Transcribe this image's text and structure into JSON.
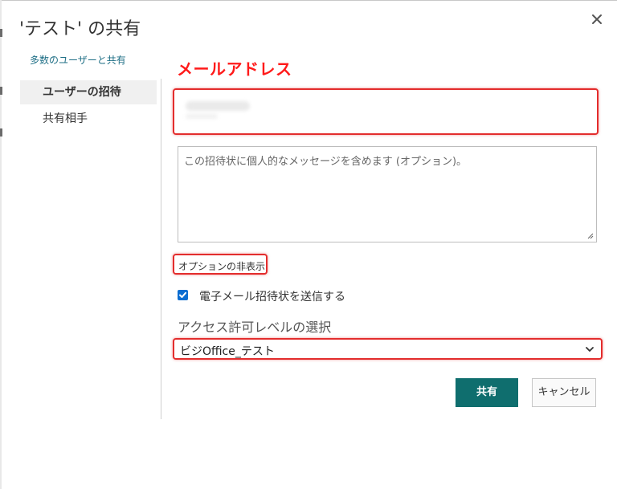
{
  "dialog": {
    "title": "'テスト' の共有",
    "manage_link": "多数のユーザーと共有"
  },
  "nav": {
    "items": [
      {
        "label": "ユーザーの招待",
        "active": true
      },
      {
        "label": "共有相手",
        "active": false
      }
    ]
  },
  "annotation": {
    "email_label": "メールアドレス",
    "highlight_color": "#e32d2d"
  },
  "invite": {
    "email_value": "",
    "message_placeholder": "この招待状に個人的なメッセージを含めます (オプション)。",
    "options_toggle": "オプションの非表示",
    "send_email_checked": true,
    "send_email_label": "電子メール招待状を送信する",
    "permission_heading": "アクセス許可レベルの選択",
    "permission_selected": "ビジOffice_テスト"
  },
  "buttons": {
    "share": "共有",
    "cancel": "キャンセル",
    "share_color": "#0f6e6e"
  },
  "icons": {
    "close": "close-icon",
    "checkbox": "checkmark-icon",
    "select": "chevron-down-icon",
    "resize": "resize-grip-icon"
  }
}
